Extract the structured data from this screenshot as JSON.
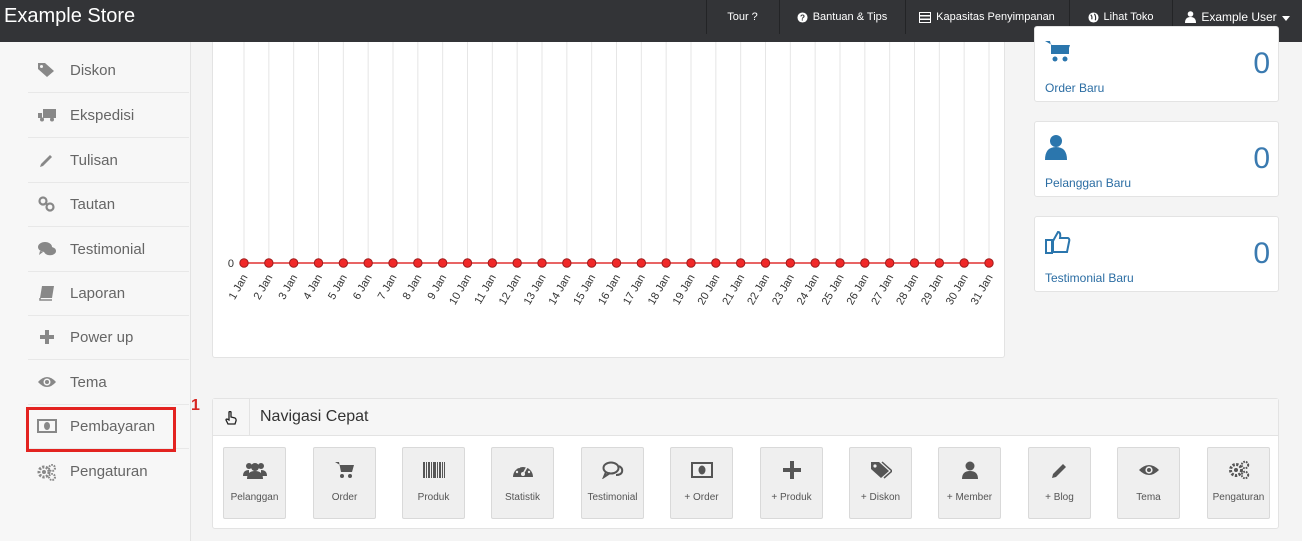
{
  "navbar": {
    "brand": "Example Store",
    "items": [
      {
        "label": "Tour ?",
        "icon": ""
      },
      {
        "label": "Bantuan & Tips",
        "icon": "question-icon"
      },
      {
        "label": "Kapasitas Penyimpanan",
        "icon": "server-icon"
      },
      {
        "label": "Lihat Toko",
        "icon": "globe-icon"
      },
      {
        "label": "Example User",
        "icon": "user-icon"
      }
    ]
  },
  "sidebar": {
    "items": [
      {
        "label": "Diskon",
        "icon": "tags-icon"
      },
      {
        "label": "Ekspedisi",
        "icon": "truck-icon"
      },
      {
        "label": "Tulisan",
        "icon": "pencil-icon"
      },
      {
        "label": "Tautan",
        "icon": "link-icon"
      },
      {
        "label": "Testimonial",
        "icon": "comments-icon"
      },
      {
        "label": "Laporan",
        "icon": "book-icon"
      },
      {
        "label": "Power up",
        "icon": "plus-icon"
      },
      {
        "label": "Tema",
        "icon": "eye-icon"
      },
      {
        "label": "Pembayaran",
        "icon": "money-icon"
      },
      {
        "label": "Pengaturan",
        "icon": "cogs-icon"
      }
    ],
    "highlight_marker": "1"
  },
  "chart_data": {
    "type": "line",
    "categories": [
      "1 Jan",
      "2 Jan",
      "3 Jan",
      "4 Jan",
      "5 Jan",
      "6 Jan",
      "7 Jan",
      "8 Jan",
      "9 Jan",
      "10 Jan",
      "11 Jan",
      "12 Jan",
      "13 Jan",
      "14 Jan",
      "15 Jan",
      "16 Jan",
      "17 Jan",
      "18 Jan",
      "19 Jan",
      "20 Jan",
      "21 Jan",
      "22 Jan",
      "23 Jan",
      "24 Jan",
      "25 Jan",
      "26 Jan",
      "27 Jan",
      "28 Jan",
      "29 Jan",
      "30 Jan",
      "31 Jan"
    ],
    "values": [
      0,
      0,
      0,
      0,
      0,
      0,
      0,
      0,
      0,
      0,
      0,
      0,
      0,
      0,
      0,
      0,
      0,
      0,
      0,
      0,
      0,
      0,
      0,
      0,
      0,
      0,
      0,
      0,
      0,
      0,
      0
    ],
    "y_tick": "0",
    "grid": true,
    "line_color": "#e03030",
    "point_color": "#f02828"
  },
  "stats": [
    {
      "label": "Order Baru",
      "value": "0",
      "icon": "cart-icon"
    },
    {
      "label": "Pelanggan Baru",
      "value": "0",
      "icon": "user-icon"
    },
    {
      "label": "Testimonial Baru",
      "value": "0",
      "icon": "thumbs-up-icon"
    }
  ],
  "quick_nav": {
    "title": "Navigasi Cepat",
    "buttons": [
      {
        "label": "Pelanggan",
        "icon": "users-icon"
      },
      {
        "label": "Order",
        "icon": "cart-icon"
      },
      {
        "label": "Produk",
        "icon": "barcode-icon"
      },
      {
        "label": "Statistik",
        "icon": "dashboard-icon"
      },
      {
        "label": "Testimonial",
        "icon": "comments-icon"
      },
      {
        "label": "+ Order",
        "icon": "money-icon"
      },
      {
        "label": "+ Produk",
        "icon": "plus-icon"
      },
      {
        "label": "+ Diskon",
        "icon": "tags-icon"
      },
      {
        "label": "+ Member",
        "icon": "user-icon"
      },
      {
        "label": "+ Blog",
        "icon": "pencil-icon"
      },
      {
        "label": "Tema",
        "icon": "eye-icon"
      },
      {
        "label": "Pengaturan",
        "icon": "cogs-icon"
      }
    ]
  }
}
